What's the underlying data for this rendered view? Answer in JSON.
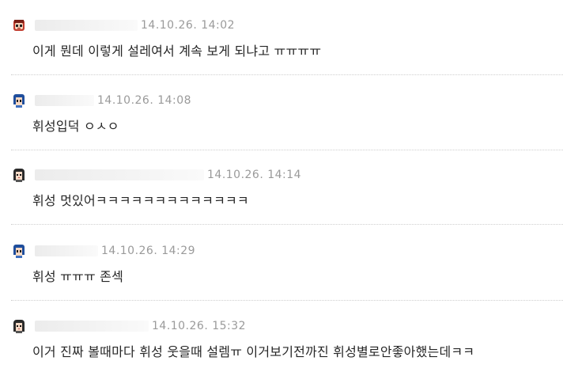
{
  "comments": [
    {
      "avatar_icon": "red-character-avatar-icon",
      "date": "14.10.26. 14:02",
      "text": "이게 뭔데 이렇게 설레여서 계속 보게 되냐고 ㅠㅠㅠㅠ"
    },
    {
      "avatar_icon": "blue-hair-character-avatar-icon",
      "date": "14.10.26. 14:08",
      "text": "휘성입덕 ㅇㅅㅇ"
    },
    {
      "avatar_icon": "dark-hair-character-avatar-icon",
      "date": "14.10.26. 14:14",
      "text": "휘성 멋있어ㅋㅋㅋㅋㅋㅋㅋㅋㅋㅋㅋㅋㅋ"
    },
    {
      "avatar_icon": "blue-hair-character-avatar-icon",
      "date": "14.10.26. 14:29",
      "text": "휘성 ㅠㅠㅠ 존섹"
    },
    {
      "avatar_icon": "dark-hair-character-avatar-icon",
      "date": "14.10.26. 15:32",
      "text": "이거 진짜 볼때마다 휘성 웃을때 설렘ㅠ 이거보기전까진 휘성별로안좋아했는데ㅋㅋ"
    }
  ]
}
